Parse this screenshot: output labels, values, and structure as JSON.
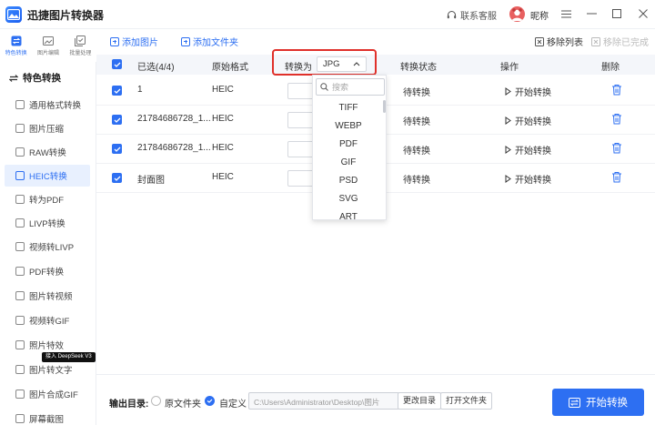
{
  "app": {
    "title": "迅捷图片转换器"
  },
  "titlebar": {
    "support_label": "联系客服",
    "nickname": "昵称"
  },
  "rail": [
    {
      "label": "特色转换",
      "icon": "transform-icon",
      "active": true
    },
    {
      "label": "图片编辑",
      "icon": "image-edit-icon",
      "active": false
    },
    {
      "label": "批量处理",
      "icon": "batch-icon",
      "active": false
    }
  ],
  "sidebar": {
    "heading": "特色转换",
    "items": [
      {
        "label": "通用格式转换",
        "active": false
      },
      {
        "label": "图片压缩",
        "active": false
      },
      {
        "label": "RAW转换",
        "active": false
      },
      {
        "label": "HEIC转换",
        "active": true
      },
      {
        "label": "转为PDF",
        "active": false
      },
      {
        "label": "LIVP转换",
        "active": false
      },
      {
        "label": "视频转LIVP",
        "active": false
      },
      {
        "label": "PDF转换",
        "active": false
      },
      {
        "label": "图片转视频",
        "active": false
      },
      {
        "label": "视频转GIF",
        "active": false
      },
      {
        "label": "照片特效",
        "active": false
      },
      {
        "label": "图片转文字",
        "active": false
      },
      {
        "label": "图片合成GIF",
        "active": false
      },
      {
        "label": "屏幕截图",
        "active": false
      }
    ],
    "badge": "接入 DeepSeek V3"
  },
  "toolbar": {
    "add_image": "添加图片",
    "add_folder": "添加文件夹",
    "remove_list": "移除列表",
    "remove_done": "移除已完成"
  },
  "table": {
    "headers": {
      "selected": "已选(4/4)",
      "original_format": "原始格式",
      "convert_to": "转换为",
      "status": "转换状态",
      "action": "操作",
      "delete": "删除"
    },
    "target_format": "JPG",
    "rows": [
      {
        "name": "1",
        "format": "HEIC",
        "status": "待转换",
        "action": "开始转换"
      },
      {
        "name": "21784686728_1...",
        "format": "HEIC",
        "status": "待转换",
        "action": "开始转换"
      },
      {
        "name": "21784686728_1...",
        "format": "HEIC",
        "status": "待转换",
        "action": "开始转换"
      },
      {
        "name": "封面图",
        "format": "HEIC",
        "status": "待转换",
        "action": "开始转换"
      }
    ]
  },
  "dropdown": {
    "search_placeholder": "搜索",
    "options": [
      "TIFF",
      "WEBP",
      "PDF",
      "GIF",
      "PSD",
      "SVG",
      "ART"
    ]
  },
  "bottom": {
    "output_label": "输出目录:",
    "option_original": "原文件夹",
    "option_custom": "自定义",
    "selected_option": "自定义",
    "path": "C:\\Users\\Administrator\\Desktop\\图片",
    "change_dir": "更改目录",
    "open_folder": "打开文件夹",
    "convert": "开始转换"
  },
  "colors": {
    "accent": "#2d6ff2",
    "highlight": "#e0302a"
  }
}
